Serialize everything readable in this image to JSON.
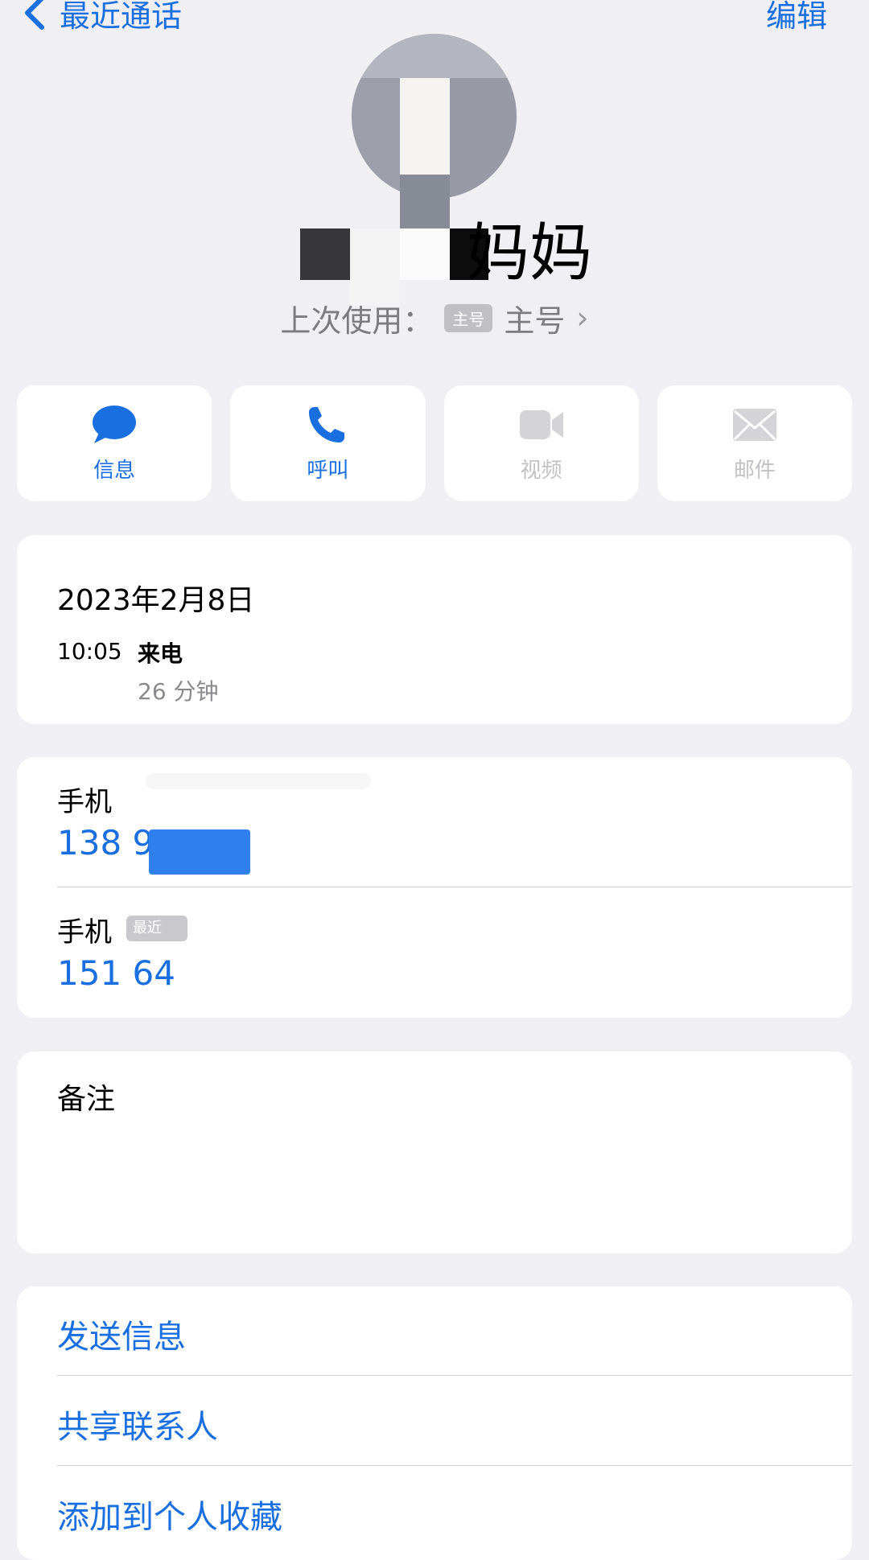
{
  "nav": {
    "back_label": "最近通话",
    "edit_label": "编辑"
  },
  "contact": {
    "name_suffix": "妈妈",
    "last_used_prefix": "上次使用：",
    "last_used_tag": "主号",
    "last_used_value": "主号"
  },
  "actions": [
    {
      "label": "信息",
      "icon": "message-bubble-icon",
      "enabled": true
    },
    {
      "label": "呼叫",
      "icon": "phone-icon",
      "enabled": true
    },
    {
      "label": "视频",
      "icon": "video-camera-icon",
      "enabled": false
    },
    {
      "label": "邮件",
      "icon": "envelope-icon",
      "enabled": false
    }
  ],
  "recent_call": {
    "date": "2023年2月8日",
    "time": "10:05",
    "type": "来电",
    "duration": "26 分钟"
  },
  "phones": [
    {
      "label": "手机",
      "number": "138 9"
    },
    {
      "label": "手机",
      "tag": "最近",
      "number": "151 64"
    }
  ],
  "notes": {
    "label": "备注"
  },
  "links": [
    {
      "label": "发送信息"
    },
    {
      "label": "共享联系人"
    },
    {
      "label": "添加到个人收藏"
    }
  ],
  "colors": {
    "accent": "#1a6fe0",
    "background": "#efeff4",
    "card": "#ffffff",
    "disabled": "#c2c2c6"
  }
}
